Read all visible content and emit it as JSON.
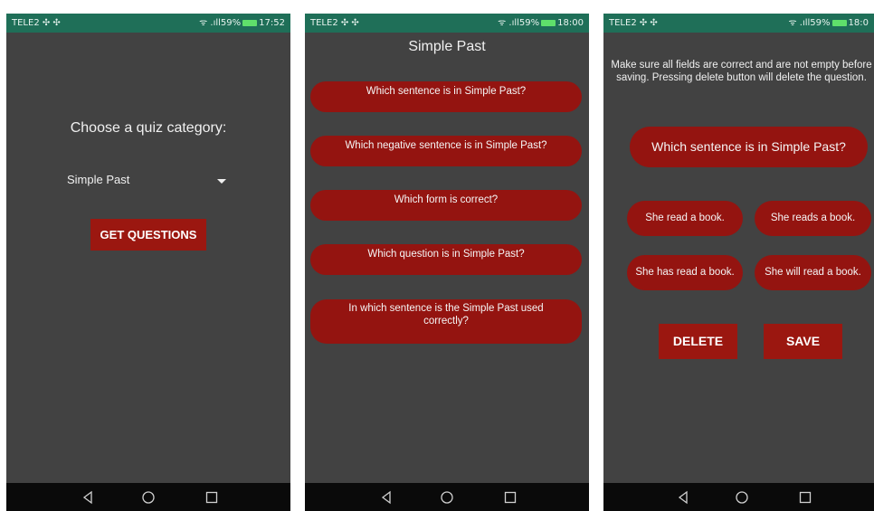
{
  "status": {
    "carrier": "TELE2 ✣ ✣",
    "signal": "ᯤ .ıll59%",
    "times": [
      "17:52",
      "18:00",
      "18:0"
    ]
  },
  "screen1": {
    "title": "Choose a quiz category:",
    "category": "Simple Past",
    "button": "GET QUESTIONS"
  },
  "screen2": {
    "title": "Simple Past",
    "questions": [
      "Which sentence is in Simple Past?",
      "Which negative sentence is in Simple Past?",
      "Which form is correct?",
      "Which question is in Simple Past?",
      "In which sentence is the Simple Past used correctly?"
    ]
  },
  "screen3": {
    "notice": "Make sure all fields are correct and are not empty before saving. Pressing delete button will delete the question.",
    "question": "Which sentence is in Simple Past?",
    "answers": [
      "She read a book.",
      "She reads a book.",
      "She has read a book.",
      "She will read a book."
    ],
    "delete": "DELETE",
    "save": "SAVE"
  },
  "icons": {
    "back": "triangle-back-icon",
    "home": "circle-home-icon",
    "recent": "square-recent-icon"
  },
  "colors": {
    "status_bar": "#1f6f58",
    "background": "#424242",
    "accent": "#9b1710",
    "nav_bar": "#0a0a0a"
  }
}
